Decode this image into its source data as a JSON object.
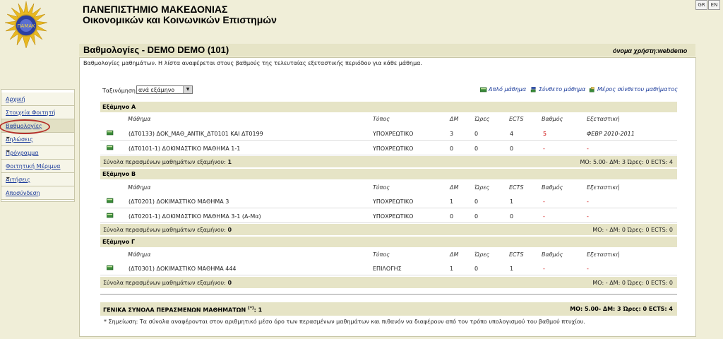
{
  "header": {
    "university": "ΠΑΝΕΠΙΣΤΗΜΙΟ ΜΑΚΕΔΟΝΙΑΣ",
    "school": "Οικονομικών και Κοινωνικών Επιστημών",
    "lang_gr": "GR",
    "lang_en": "EN"
  },
  "page": {
    "title": "Βαθμολογίες - DEMO DEMO (101)",
    "username": "όνομα χρήστη:webdemo",
    "description": "Βαθμολογίες μαθημάτων. Η λίστα αναφέρεται στους βαθμούς της τελευταίας εξεταστικής περιόδου για κάθε μάθημα."
  },
  "sidebar": {
    "items": [
      {
        "label": "Αρχική",
        "arrow": ""
      },
      {
        "label": "Στοιχεία Φοιτητή",
        "arrow": ""
      },
      {
        "label": "Βαθμολογίες",
        "arrow": ""
      },
      {
        "label": "Δηλώσεις",
        "arrow": "⏷"
      },
      {
        "label": "Πρόγραμμα",
        "arrow": "⏷"
      },
      {
        "label": "Φοιτητική Μέριμνα",
        "arrow": ""
      },
      {
        "label": "Αιτήσεις",
        "arrow": "⏷"
      },
      {
        "label": "Αποσύνδεση",
        "arrow": ""
      }
    ]
  },
  "sort": {
    "label": "Ταξινόμηση:",
    "value": "ανά εξάμηνο"
  },
  "legend": {
    "simple": "Απλό μάθημα",
    "composite": "Σύνθετο μάθημα",
    "part": "Μέρος σύνθετου μαθήματος"
  },
  "columns": {
    "course": "Μάθημα",
    "type": "Τύπος",
    "dm": "ΔΜ",
    "hours": "Ώρες",
    "ects": "ECTS",
    "grade": "Βαθμός",
    "exam": "Εξεταστική"
  },
  "totals_label": "Σύνολα περασμένων μαθημάτων εξαμήνου:",
  "semesters": [
    {
      "name": "Εξάμηνο Α",
      "courses": [
        {
          "name": "(ΔΤ0133)  ΔΟΚ_ΜΑΘ_ΑΝΤΙΚ_ΔΤ0101 ΚΑΙ ΔΤ0199",
          "type": "ΥΠΟΧΡΕΩΤΙΚΟ",
          "dm": "3",
          "hours": "0",
          "ects": "4",
          "grade": "5",
          "exam": "ΦΕΒΡ  2010-2011"
        },
        {
          "name": "(ΔΤ0101-1)  ΔΟΚΙΜΑΣΤΙΚΟ ΜΑΘΗΜΑ 1-1",
          "type": "ΥΠΟΧΡΕΩΤΙΚΟ",
          "dm": "0",
          "hours": "0",
          "ects": "0",
          "grade": "-",
          "exam": "-"
        }
      ],
      "totals": {
        "count": "1",
        "mo": "5.00",
        "dm": "3",
        "hours": "0",
        "ects": "4"
      }
    },
    {
      "name": "Εξάμηνο Β",
      "courses": [
        {
          "name": "(ΔΤ0201)  ΔΟΚΙΜΑΣΤΙΚΟ ΜΑΘΗΜΑ 3",
          "type": "ΥΠΟΧΡΕΩΤΙΚΟ",
          "dm": "1",
          "hours": "0",
          "ects": "1",
          "grade": "-",
          "exam": "-"
        },
        {
          "name": "(ΔΤ0201-1)  ΔΟΚΙΜΑΣΤΙΚΟ ΜΑΘΗΜΑ 3-1 (Α-Μα)",
          "type": "ΥΠΟΧΡΕΩΤΙΚΟ",
          "dm": "0",
          "hours": "0",
          "ects": "0",
          "grade": "-",
          "exam": "-"
        }
      ],
      "totals": {
        "count": "0",
        "mo": "-",
        "dm": "0",
        "hours": "0",
        "ects": "0"
      }
    },
    {
      "name": "Εξάμηνο Γ",
      "courses": [
        {
          "name": "(ΔΤ0301)  ΔΟΚΙΜΑΣΤΙΚΟ ΜΑΘΗΜΑ 444",
          "type": "ΕΠΙΛΟΓΗΣ",
          "dm": "1",
          "hours": "0",
          "ects": "1",
          "grade": "-",
          "exam": "-"
        }
      ],
      "totals": {
        "count": "0",
        "mo": "-",
        "dm": "0",
        "hours": "0",
        "ects": "0"
      }
    }
  ],
  "summary_labels": {
    "mo": "ΜΟ:",
    "dm": "ΔΜ:",
    "hours": "Ώρες:",
    "ects": "ECTS:"
  },
  "general": {
    "label": "ΓΕΝΙΚΑ ΣΥΝΟΛΑ ΠΕΡΑΣΜΕΝΩΝ ΜΑΘΗΜΑΤΩΝ",
    "asterisk": "(*)",
    "count": ": 1",
    "mo": "5.00",
    "dm": "3",
    "hours": "0",
    "ects": "4"
  },
  "note": "* Σημείωση: Τα σύνολα αναφέρονται στον αριθμητικό μέσο όρο των περασμένων μαθημάτων και πιθανόν να διαφέρουν από τον τρόπο υπολογισμού του βαθμού πτυχίου.",
  "colors": {
    "accent_red": "#cc0000",
    "link_blue": "#1a3a9a",
    "band": "#e6e4c6"
  }
}
